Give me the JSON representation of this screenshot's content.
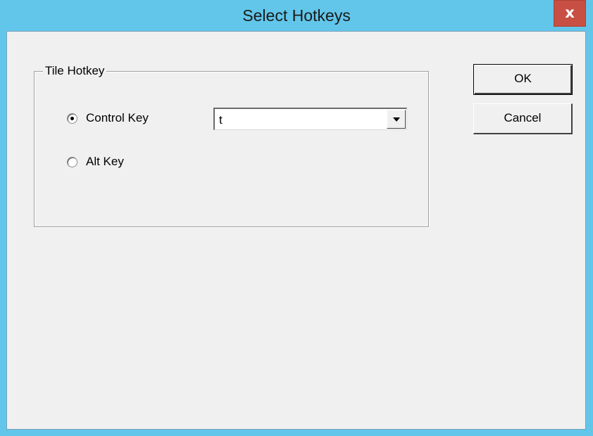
{
  "window": {
    "title": "Select Hotkeys",
    "close_glyph": "x"
  },
  "group": {
    "label": "Tile Hotkey",
    "options": [
      {
        "label": "Control Key",
        "selected": true
      },
      {
        "label": "Alt Key",
        "selected": false
      }
    ],
    "key_select": {
      "value": "t",
      "arrow_icon": "chevron-down-icon"
    }
  },
  "buttons": {
    "ok_label": "OK",
    "cancel_label": "Cancel"
  },
  "colors": {
    "titlebar": "#62c6ea",
    "close_button": "#c74f43",
    "dialog_face": "#f0f0f0"
  }
}
